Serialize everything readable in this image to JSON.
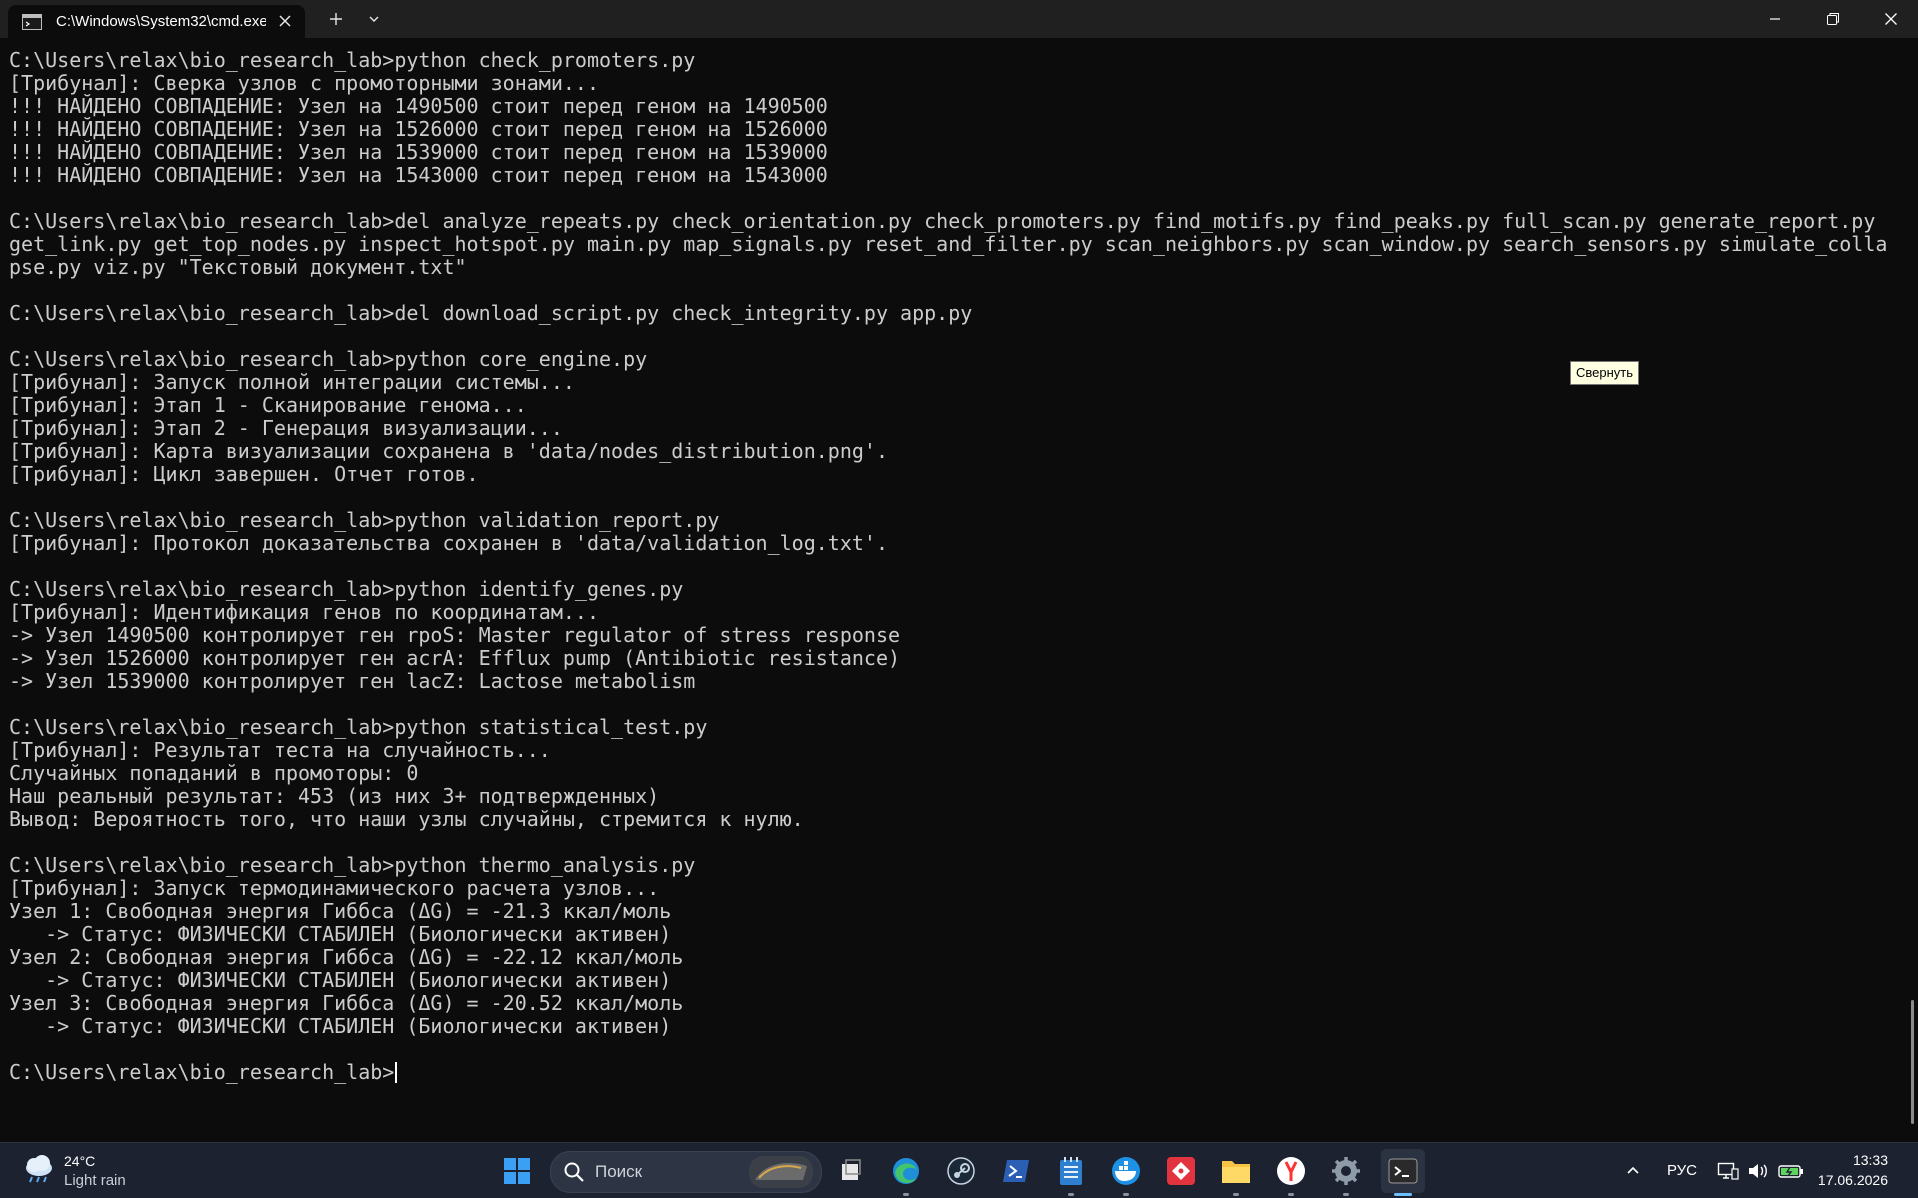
{
  "window": {
    "tab_title": "C:\\Windows\\System32\\cmd.exe"
  },
  "tooltip": "Свернуть",
  "terminal": {
    "prompt": "C:\\Users\\relax\\bio_research_lab>",
    "lines": [
      "C:\\Users\\relax\\bio_research_lab>python check_promoters.py",
      "[Трибунал]: Сверка узлов с промоторными зонами...",
      "!!! НАЙДЕНО СОВПАДЕНИЕ: Узел на 1490500 стоит перед геном на 1490500",
      "!!! НАЙДЕНО СОВПАДЕНИЕ: Узел на 1526000 стоит перед геном на 1526000",
      "!!! НАЙДЕНО СОВПАДЕНИЕ: Узел на 1539000 стоит перед геном на 1539000",
      "!!! НАЙДЕНО СОВПАДЕНИЕ: Узел на 1543000 стоит перед геном на 1543000",
      "",
      "C:\\Users\\relax\\bio_research_lab>del analyze_repeats.py check_orientation.py check_promoters.py find_motifs.py find_peaks.py full_scan.py generate_report.py",
      "get_link.py get_top_nodes.py inspect_hotspot.py main.py map_signals.py reset_and_filter.py scan_neighbors.py scan_window.py search_sensors.py simulate_colla",
      "pse.py viz.py \"Текстовый документ.txt\"",
      "",
      "C:\\Users\\relax\\bio_research_lab>del download_script.py check_integrity.py app.py",
      "",
      "C:\\Users\\relax\\bio_research_lab>python core_engine.py",
      "[Трибунал]: Запуск полной интеграции системы...",
      "[Трибунал]: Этап 1 - Сканирование генома...",
      "[Трибунал]: Этап 2 - Генерация визуализации...",
      "[Трибунал]: Карта визуализации сохранена в 'data/nodes_distribution.png'.",
      "[Трибунал]: Цикл завершен. Отчет готов.",
      "",
      "C:\\Users\\relax\\bio_research_lab>python validation_report.py",
      "[Трибунал]: Протокол доказательства сохранен в 'data/validation_log.txt'.",
      "",
      "C:\\Users\\relax\\bio_research_lab>python identify_genes.py",
      "[Трибунал]: Идентификация генов по координатам...",
      "-> Узел 1490500 контролирует ген rpoS: Master regulator of stress response",
      "-> Узел 1526000 контролирует ген acrA: Efflux pump (Antibiotic resistance)",
      "-> Узел 1539000 контролирует ген lacZ: Lactose metabolism",
      "",
      "C:\\Users\\relax\\bio_research_lab>python statistical_test.py",
      "[Трибунал]: Результат теста на случайность...",
      "Случайных попаданий в промоторы: 0",
      "Наш реальный результат: 453 (из них 3+ подтвержденных)",
      "Вывод: Вероятность того, что наши узлы случайны, стремится к нулю.",
      "",
      "C:\\Users\\relax\\bio_research_lab>python thermo_analysis.py",
      "[Трибунал]: Запуск термодинамического расчета узлов...",
      "Узел 1: Свободная энергия Гиббса (ΔG) = -21.3 ккал/моль",
      "   -> Статус: ФИЗИЧЕСКИ СТАБИЛЕН (Биологически активен)",
      "Узел 2: Свободная энергия Гиббса (ΔG) = -22.12 ккал/моль",
      "   -> Статус: ФИЗИЧЕСКИ СТАБИЛЕН (Биологически активен)",
      "Узел 3: Свободная энергия Гиббса (ΔG) = -20.52 ккал/моль",
      "   -> Статус: ФИЗИЧЕСКИ СТАБИЛЕН (Биологически активен)",
      ""
    ]
  },
  "taskbar": {
    "weather_temp": "24°C",
    "weather_desc": "Light rain",
    "search_placeholder": "Поиск",
    "apps": [
      "windows-start",
      "search",
      "task-view",
      "edge",
      "steam",
      "powershell",
      "notepad",
      "docker",
      "git-app",
      "file-explorer",
      "yandex-browser",
      "settings",
      "terminal"
    ],
    "language": "РУС",
    "time": "13:33",
    "date": "17.06.2026"
  }
}
